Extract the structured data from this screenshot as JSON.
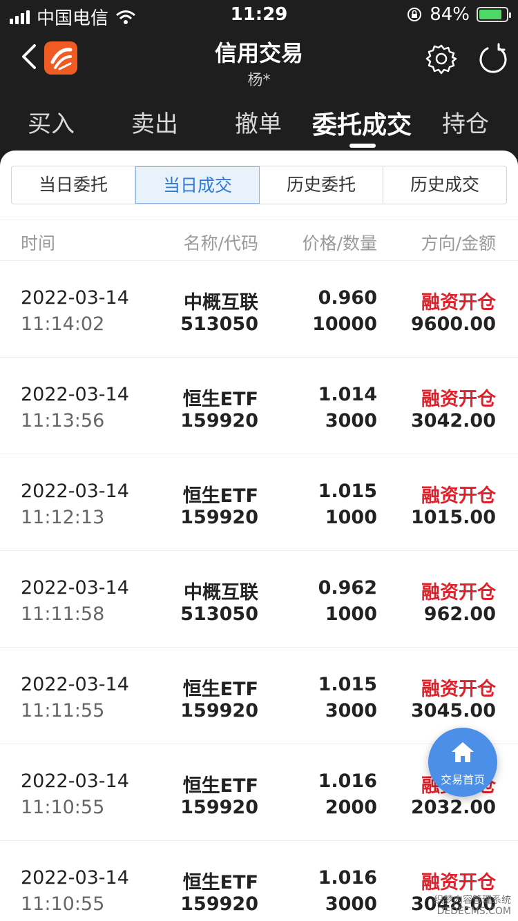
{
  "status_bar": {
    "carrier": "中国电信",
    "time": "11:29",
    "battery_percent": "84%",
    "battery_level": 0.84
  },
  "header": {
    "title": "信用交易",
    "subtitle": "杨*"
  },
  "main_tabs": [
    {
      "label": "买入"
    },
    {
      "label": "卖出"
    },
    {
      "label": "撤单"
    },
    {
      "label": "委托成交",
      "active": true
    },
    {
      "label": "持仓"
    }
  ],
  "sub_tabs": [
    {
      "label": "当日委托"
    },
    {
      "label": "当日成交",
      "active": true
    },
    {
      "label": "历史委托"
    },
    {
      "label": "历史成交"
    }
  ],
  "columns": {
    "time": "时间",
    "name_code": "名称/代码",
    "price_qty": "价格/数量",
    "dir_amount": "方向/金额"
  },
  "rows": [
    {
      "date": "2022-03-14",
      "time": "11:14:02",
      "name": "中概互联",
      "code": "513050",
      "price": "0.960",
      "qty": "10000",
      "direction": "融资开仓",
      "amount": "9600.00"
    },
    {
      "date": "2022-03-14",
      "time": "11:13:56",
      "name": "恒生ETF",
      "code": "159920",
      "price": "1.014",
      "qty": "3000",
      "direction": "融资开仓",
      "amount": "3042.00"
    },
    {
      "date": "2022-03-14",
      "time": "11:12:13",
      "name": "恒生ETF",
      "code": "159920",
      "price": "1.015",
      "qty": "1000",
      "direction": "融资开仓",
      "amount": "1015.00"
    },
    {
      "date": "2022-03-14",
      "time": "11:11:58",
      "name": "中概互联",
      "code": "513050",
      "price": "0.962",
      "qty": "1000",
      "direction": "融资开仓",
      "amount": "962.00"
    },
    {
      "date": "2022-03-14",
      "time": "11:11:55",
      "name": "恒生ETF",
      "code": "159920",
      "price": "1.015",
      "qty": "3000",
      "direction": "融资开仓",
      "amount": "3045.00"
    },
    {
      "date": "2022-03-14",
      "time": "11:10:55",
      "name": "恒生ETF",
      "code": "159920",
      "price": "1.016",
      "qty": "2000",
      "direction": "融资开仓",
      "amount": "2032.00"
    },
    {
      "date": "2022-03-14",
      "time": "11:10:55",
      "name": "恒生ETF",
      "code": "159920",
      "price": "1.016",
      "qty": "3000",
      "direction": "融资开仓",
      "amount": "3048.00"
    }
  ],
  "fab": {
    "label": "交易首页"
  },
  "watermark": {
    "line1": "织梦内容管理系统",
    "line2": "DEDECMS.COM"
  },
  "colors": {
    "header_bg": "#1e1e1e",
    "accent_blue": "#2f7bd8",
    "direction_red": "#e0202a",
    "fab_blue": "#4b8fe8",
    "logo_orange": "#f05a23"
  }
}
